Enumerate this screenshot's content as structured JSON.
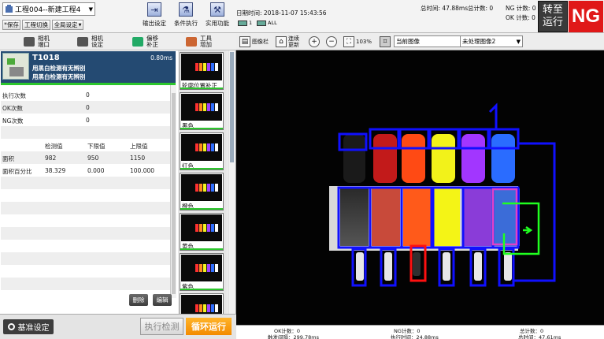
{
  "header": {
    "project_title": "工程004--新建工程4",
    "save_label": "*保存",
    "switch_label": "工程切换",
    "global_settings_label": "全局设定",
    "output_settings": "输出设定",
    "conditional_exec": "条件执行",
    "utility": "实用功能",
    "datetime_label": "日期时间: 2018-11-07 15:43:56",
    "total_time": "总时间: 47.88ms",
    "total_count": "总计数: 0",
    "ng_count": "NG 计数: 0",
    "ok_count": "OK 计数: 0",
    "run_label_1": "转至",
    "run_label_2": "运行",
    "result": "NG"
  },
  "left_tabs": {
    "camera_port": "相机\n端口",
    "camera_settings": "相机\n设定",
    "offset_correction": "偏移\n补正",
    "tool_add": "工具\n增加"
  },
  "unit": {
    "id": "T1018",
    "time": "0.80ms",
    "name_1": "用黑白检测有无辨别",
    "name_2": "用黑白检测有无辨别"
  },
  "details": {
    "exec_count_label": "执行次数",
    "exec_count": "0",
    "ok_label": "OK次数",
    "ok_value": "0",
    "ng_label": "NG次数",
    "ng_value": "0",
    "col_measured": "检测值",
    "col_lower": "下限值",
    "col_upper": "上限值",
    "area_label": "面积",
    "area_value": "982",
    "area_lower": "950",
    "area_upper": "1150",
    "area_pct_label": "面积百分比",
    "area_pct_value": "38.329",
    "area_pct_lower": "0.000",
    "area_pct_upper": "100.000",
    "delete_label": "删除",
    "edit_label": "编辑"
  },
  "thumbnails": [
    "轮廓位置补正",
    "黑色",
    "红色",
    "橙色",
    "黄色",
    "紫色",
    ""
  ],
  "bottom": {
    "base_settings": "基准设定",
    "exec_check": "执行检测",
    "loop_run": "循环运行"
  },
  "viewer_toolbar": {
    "image_bar": "图像栏",
    "continuous_update": "连续\n更新",
    "zoom": "103%",
    "image_select": "当前图像",
    "process_select": "未处理图像2",
    "cam_tab_1": "1",
    "cam_tab_all": "ALL"
  },
  "status_bar": {
    "ok_count": "OK计数：0",
    "ng_count": "NG计数：0",
    "total_count": "总计数：0",
    "trigger_interval": "触发间隔：299.78ms",
    "exec_time": "执行时间：24.88ms",
    "total_time": "总时间：47.61ms"
  },
  "colors": {
    "result_ng": "#e01818",
    "loop_button": "#f6950f",
    "unit_header": "#244a72",
    "ok_green": "#2cc62c",
    "roi_blue": "#1010ff"
  },
  "icons": [
    "project-icon",
    "output-settings-icon",
    "conditional-exec-icon",
    "utility-icon",
    "camera-icon",
    "offset-icon",
    "tool-icon",
    "image-bar-icon",
    "continuous-update-icon",
    "zoom-in-icon",
    "zoom-out-icon",
    "fit-icon",
    "roi-icon",
    "gear-icon"
  ]
}
